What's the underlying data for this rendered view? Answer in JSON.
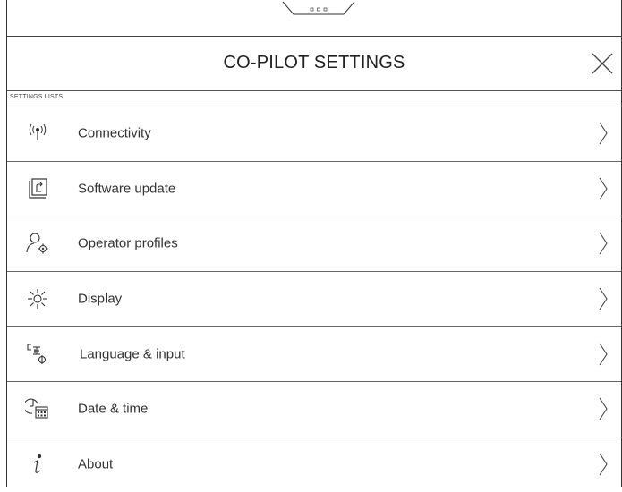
{
  "header": {
    "title": "CO-PILOT SETTINGS"
  },
  "section": {
    "label": "SETTINGS LISTS"
  },
  "items": [
    {
      "label": "Connectivity",
      "icon": "antenna-icon"
    },
    {
      "label": "Software update",
      "icon": "software-update-icon"
    },
    {
      "label": "Operator profiles",
      "icon": "operator-profile-icon"
    },
    {
      "label": "Display",
      "icon": "brightness-icon"
    },
    {
      "label": "Language & input",
      "icon": "language-icon"
    },
    {
      "label": "Date & time",
      "icon": "clock-calendar-icon"
    },
    {
      "label": "About",
      "icon": "info-icon"
    }
  ]
}
